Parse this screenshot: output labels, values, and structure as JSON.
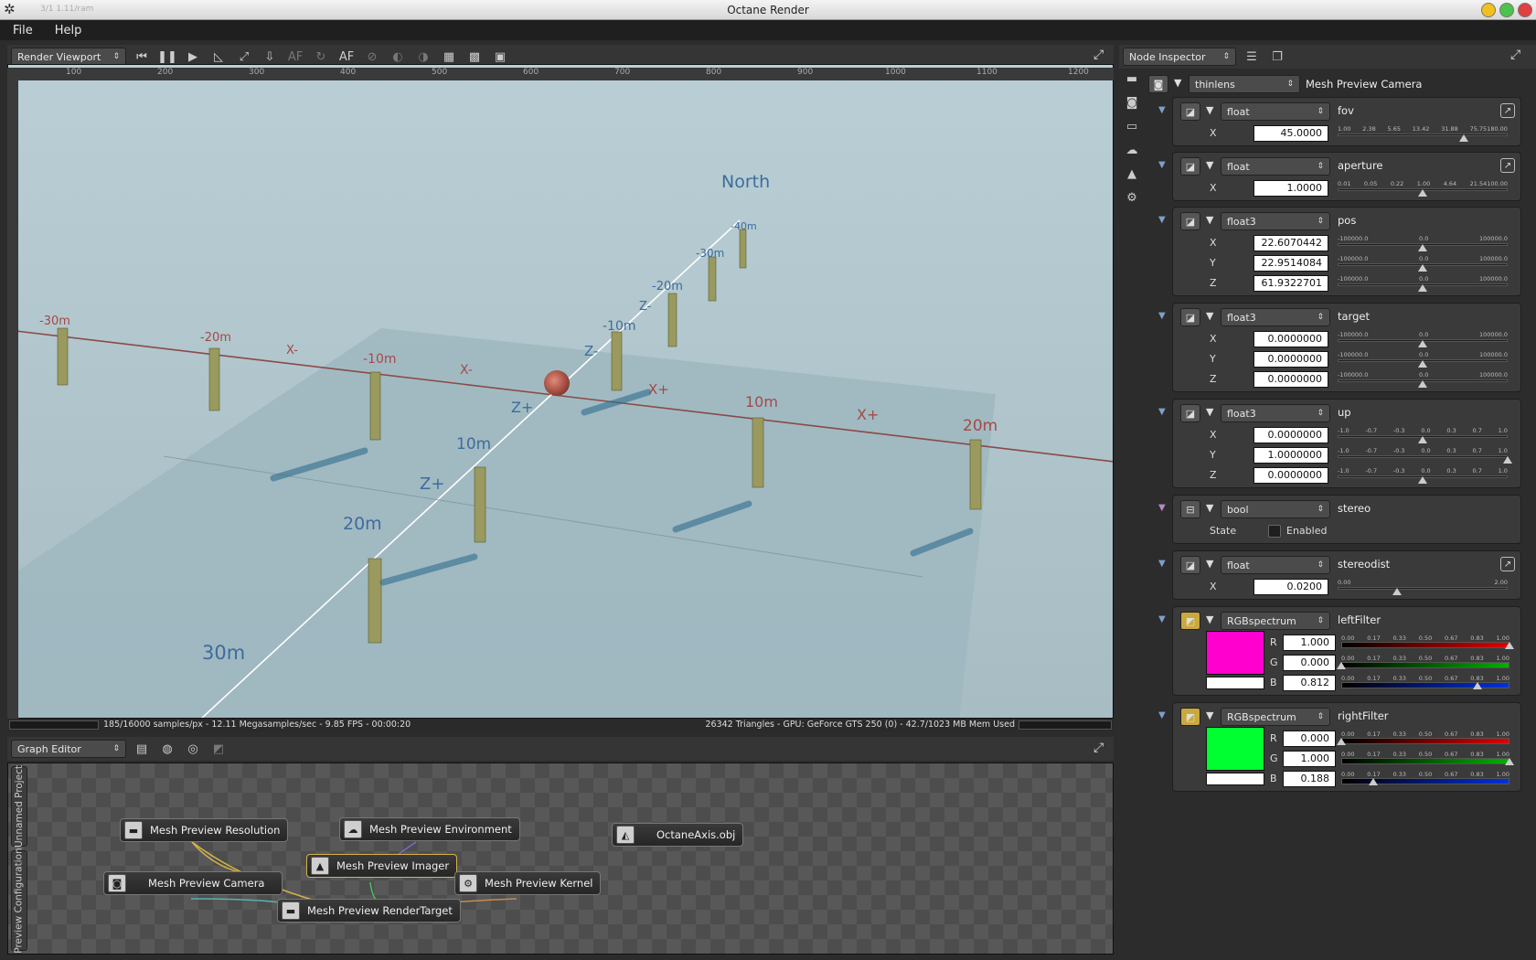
{
  "window": {
    "title": "Octane Render",
    "subtitle": "3/1 1.11/ram"
  },
  "menu": [
    "File",
    "Help"
  ],
  "viewport": {
    "panel_label": "Render Viewport",
    "ruler_h": [
      "100",
      "200",
      "300",
      "400",
      "500",
      "600",
      "700",
      "800",
      "900",
      "1000",
      "1100",
      "1200"
    ],
    "status_left": "185/16000 samples/px - 12.11 Megasamples/sec - 9.85 FPS - 00:00:20",
    "status_right": "26342 Triangles - GPU: GeForce GTS 250 (0) - 42.7/1023 MB Mem Used",
    "scene": {
      "north": "North",
      "xlabels": [
        "-30m",
        "-20m",
        "X-",
        "-10m",
        "X-",
        "X+",
        "10m",
        "X+",
        "20m"
      ],
      "zlabels": [
        "-40m",
        "-30m",
        "-20m",
        "Z-",
        "-10m",
        "Z-",
        "Z+",
        "10m",
        "Z+",
        "20m",
        "30m"
      ]
    }
  },
  "graph": {
    "panel_label": "Graph Editor",
    "tabs": [
      "Unnamed Project",
      "Preview Configuration"
    ],
    "nodes": [
      "Mesh Preview Resolution",
      "Mesh Preview Environment",
      "OctaneAxis.obj",
      "Mesh Preview Imager",
      "Mesh Preview Camera",
      "Mesh Preview Kernel",
      "Mesh Preview RenderTarget"
    ]
  },
  "inspector": {
    "panel_label": "Node Inspector",
    "root_type": "thinlens",
    "root_name": "Mesh Preview Camera",
    "fov": {
      "type": "float",
      "name": "fov",
      "x": "45.0000",
      "ticks": [
        "1.00",
        "2.38",
        "5.65",
        "13.42",
        "31.88",
        "75.75180.00"
      ],
      "pos": 0.74
    },
    "aperture": {
      "type": "float",
      "name": "aperture",
      "x": "1.0000",
      "ticks": [
        "0.01",
        "0.05",
        "0.22",
        "1.00",
        "4.64",
        "21.54100.00"
      ],
      "pos": 0.5
    },
    "pos": {
      "type": "float3",
      "name": "pos",
      "x": "22.6070442",
      "y": "22.9514084",
      "z": "61.9322701",
      "ticks": [
        "-100000.0",
        "0.0",
        "100000.0"
      ],
      "thumb": 0.5
    },
    "target": {
      "type": "float3",
      "name": "target",
      "x": "0.0000000",
      "y": "0.0000000",
      "z": "0.0000000",
      "ticks": [
        "-100000.0",
        "0.0",
        "100000.0"
      ],
      "thumb": 0.5
    },
    "up": {
      "type": "float3",
      "name": "up",
      "x": "0.0000000",
      "y": "1.0000000",
      "z": "0.0000000",
      "ticks": [
        "-1.0",
        "-0.7",
        "-0.3",
        "0.0",
        "0.3",
        "0.7",
        "1.0"
      ],
      "thumb_x": 0.5,
      "thumb_y": 1.0,
      "thumb_z": 0.5
    },
    "stereo": {
      "type": "bool",
      "name": "stereo",
      "state_label": "State",
      "enabled_label": "Enabled"
    },
    "stereodist": {
      "type": "float",
      "name": "stereodist",
      "x": "0.0200",
      "ticks": [
        "0.00",
        "2.00"
      ],
      "pos": 0.35
    },
    "leftFilter": {
      "type": "RGBspectrum",
      "name": "leftFilter",
      "r": "1.000",
      "g": "0.000",
      "b": "0.812",
      "color": "#ff00cf",
      "ticks": [
        "0.00",
        "0.17",
        "0.33",
        "0.50",
        "0.67",
        "0.83",
        "1.00"
      ]
    },
    "rightFilter": {
      "type": "RGBspectrum",
      "name": "rightFilter",
      "r": "0.000",
      "g": "1.000",
      "b": "0.188",
      "color": "#00ff30",
      "ticks": [
        "0.00",
        "0.17",
        "0.33",
        "0.50",
        "0.67",
        "0.83",
        "1.00"
      ]
    },
    "labels": {
      "x": "X",
      "y": "Y",
      "z": "Z",
      "r": "R",
      "g": "G",
      "b": "B"
    }
  }
}
